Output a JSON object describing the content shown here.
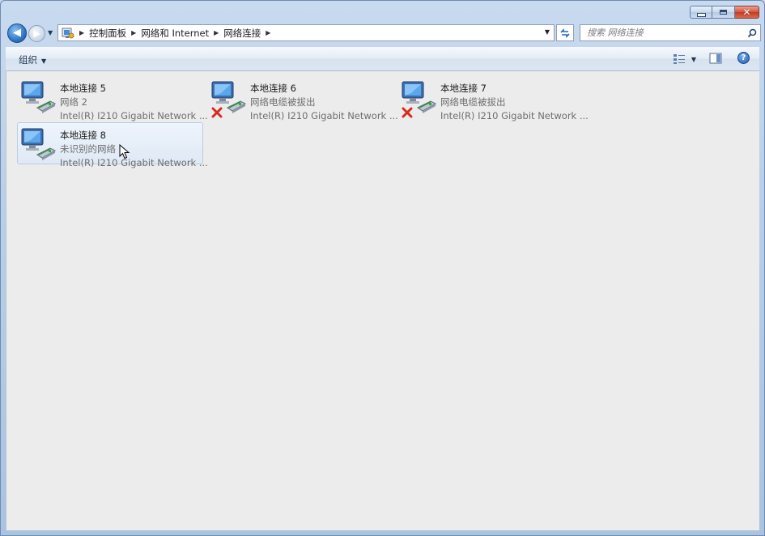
{
  "address": {
    "breadcrumbs": [
      "控制面板",
      "网络和 Internet",
      "网络连接"
    ]
  },
  "search": {
    "placeholder": "搜索 网络连接"
  },
  "toolbar": {
    "organize_label": "组织"
  },
  "connections": [
    {
      "name": "本地连接 5",
      "status": "网络  2",
      "device": "Intel(R) I210 Gigabit Network ...",
      "disconnected": false,
      "selected": false
    },
    {
      "name": "本地连接 6",
      "status": "网络电缆被拔出",
      "device": "Intel(R) I210 Gigabit Network ...",
      "disconnected": true,
      "selected": false
    },
    {
      "name": "本地连接 7",
      "status": "网络电缆被拔出",
      "device": "Intel(R) I210 Gigabit Network ...",
      "disconnected": true,
      "selected": false
    },
    {
      "name": "本地连接 8",
      "status": "未识别的网络",
      "device": "Intel(R) I210 Gigabit Network ...",
      "disconnected": false,
      "selected": true
    }
  ],
  "icons": {
    "back": "back-arrow-icon",
    "forward": "forward-arrow-icon",
    "location": "control-panel-icon",
    "refresh": "refresh-icon",
    "search": "search-icon",
    "view": "change-view-icon",
    "preview_pane": "preview-pane-icon",
    "help": "help-icon",
    "connection": "network-adapter-icon",
    "disconnected": "red-x-icon"
  },
  "colors": {
    "content_bg": "#ececec",
    "selection": "#dfe9f5",
    "disconnected": "#d62b1e"
  }
}
